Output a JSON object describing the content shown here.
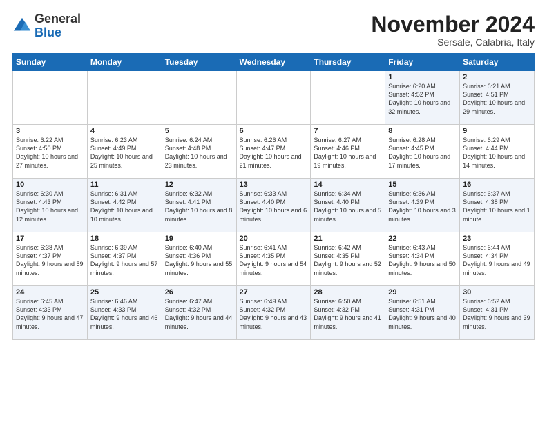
{
  "logo": {
    "general": "General",
    "blue": "Blue"
  },
  "header": {
    "month": "November 2024",
    "location": "Sersale, Calabria, Italy"
  },
  "weekdays": [
    "Sunday",
    "Monday",
    "Tuesday",
    "Wednesday",
    "Thursday",
    "Friday",
    "Saturday"
  ],
  "weeks": [
    [
      {
        "day": "",
        "info": ""
      },
      {
        "day": "",
        "info": ""
      },
      {
        "day": "",
        "info": ""
      },
      {
        "day": "",
        "info": ""
      },
      {
        "day": "",
        "info": ""
      },
      {
        "day": "1",
        "info": "Sunrise: 6:20 AM\nSunset: 4:52 PM\nDaylight: 10 hours and 32 minutes."
      },
      {
        "day": "2",
        "info": "Sunrise: 6:21 AM\nSunset: 4:51 PM\nDaylight: 10 hours and 29 minutes."
      }
    ],
    [
      {
        "day": "3",
        "info": "Sunrise: 6:22 AM\nSunset: 4:50 PM\nDaylight: 10 hours and 27 minutes."
      },
      {
        "day": "4",
        "info": "Sunrise: 6:23 AM\nSunset: 4:49 PM\nDaylight: 10 hours and 25 minutes."
      },
      {
        "day": "5",
        "info": "Sunrise: 6:24 AM\nSunset: 4:48 PM\nDaylight: 10 hours and 23 minutes."
      },
      {
        "day": "6",
        "info": "Sunrise: 6:26 AM\nSunset: 4:47 PM\nDaylight: 10 hours and 21 minutes."
      },
      {
        "day": "7",
        "info": "Sunrise: 6:27 AM\nSunset: 4:46 PM\nDaylight: 10 hours and 19 minutes."
      },
      {
        "day": "8",
        "info": "Sunrise: 6:28 AM\nSunset: 4:45 PM\nDaylight: 10 hours and 17 minutes."
      },
      {
        "day": "9",
        "info": "Sunrise: 6:29 AM\nSunset: 4:44 PM\nDaylight: 10 hours and 14 minutes."
      }
    ],
    [
      {
        "day": "10",
        "info": "Sunrise: 6:30 AM\nSunset: 4:43 PM\nDaylight: 10 hours and 12 minutes."
      },
      {
        "day": "11",
        "info": "Sunrise: 6:31 AM\nSunset: 4:42 PM\nDaylight: 10 hours and 10 minutes."
      },
      {
        "day": "12",
        "info": "Sunrise: 6:32 AM\nSunset: 4:41 PM\nDaylight: 10 hours and 8 minutes."
      },
      {
        "day": "13",
        "info": "Sunrise: 6:33 AM\nSunset: 4:40 PM\nDaylight: 10 hours and 6 minutes."
      },
      {
        "day": "14",
        "info": "Sunrise: 6:34 AM\nSunset: 4:40 PM\nDaylight: 10 hours and 5 minutes."
      },
      {
        "day": "15",
        "info": "Sunrise: 6:36 AM\nSunset: 4:39 PM\nDaylight: 10 hours and 3 minutes."
      },
      {
        "day": "16",
        "info": "Sunrise: 6:37 AM\nSunset: 4:38 PM\nDaylight: 10 hours and 1 minute."
      }
    ],
    [
      {
        "day": "17",
        "info": "Sunrise: 6:38 AM\nSunset: 4:37 PM\nDaylight: 9 hours and 59 minutes."
      },
      {
        "day": "18",
        "info": "Sunrise: 6:39 AM\nSunset: 4:37 PM\nDaylight: 9 hours and 57 minutes."
      },
      {
        "day": "19",
        "info": "Sunrise: 6:40 AM\nSunset: 4:36 PM\nDaylight: 9 hours and 55 minutes."
      },
      {
        "day": "20",
        "info": "Sunrise: 6:41 AM\nSunset: 4:35 PM\nDaylight: 9 hours and 54 minutes."
      },
      {
        "day": "21",
        "info": "Sunrise: 6:42 AM\nSunset: 4:35 PM\nDaylight: 9 hours and 52 minutes."
      },
      {
        "day": "22",
        "info": "Sunrise: 6:43 AM\nSunset: 4:34 PM\nDaylight: 9 hours and 50 minutes."
      },
      {
        "day": "23",
        "info": "Sunrise: 6:44 AM\nSunset: 4:34 PM\nDaylight: 9 hours and 49 minutes."
      }
    ],
    [
      {
        "day": "24",
        "info": "Sunrise: 6:45 AM\nSunset: 4:33 PM\nDaylight: 9 hours and 47 minutes."
      },
      {
        "day": "25",
        "info": "Sunrise: 6:46 AM\nSunset: 4:33 PM\nDaylight: 9 hours and 46 minutes."
      },
      {
        "day": "26",
        "info": "Sunrise: 6:47 AM\nSunset: 4:32 PM\nDaylight: 9 hours and 44 minutes."
      },
      {
        "day": "27",
        "info": "Sunrise: 6:49 AM\nSunset: 4:32 PM\nDaylight: 9 hours and 43 minutes."
      },
      {
        "day": "28",
        "info": "Sunrise: 6:50 AM\nSunset: 4:32 PM\nDaylight: 9 hours and 41 minutes."
      },
      {
        "day": "29",
        "info": "Sunrise: 6:51 AM\nSunset: 4:31 PM\nDaylight: 9 hours and 40 minutes."
      },
      {
        "day": "30",
        "info": "Sunrise: 6:52 AM\nSunset: 4:31 PM\nDaylight: 9 hours and 39 minutes."
      }
    ]
  ]
}
